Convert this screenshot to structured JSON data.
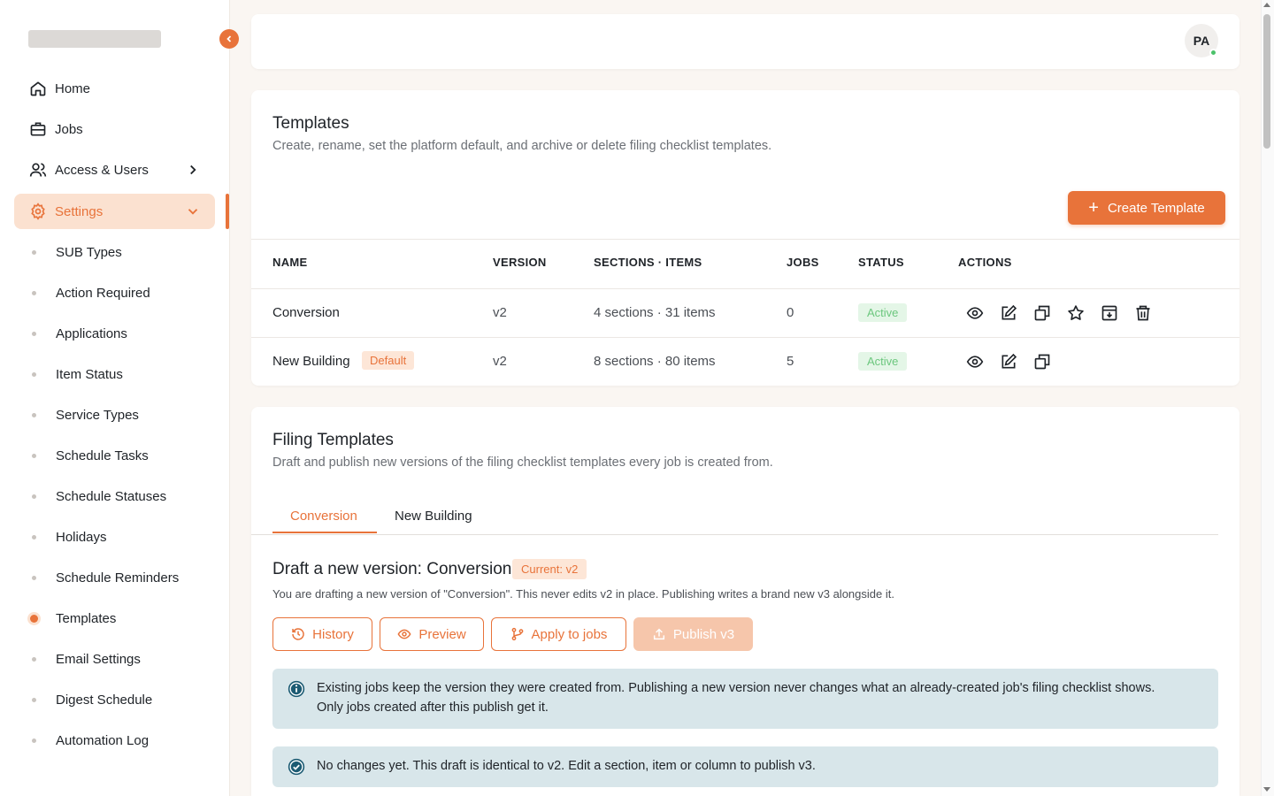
{
  "sidebar": {
    "main_items": [
      {
        "label": "Home",
        "icon": "home-icon"
      },
      {
        "label": "Jobs",
        "icon": "briefcase-icon"
      },
      {
        "label": "Access & Users",
        "icon": "users-icon"
      },
      {
        "label": "Settings",
        "icon": "gear-icon"
      }
    ],
    "sub_items": [
      "SUB Types",
      "Action Required",
      "Applications",
      "Item Status",
      "Service Types",
      "Schedule Tasks",
      "Schedule Statuses",
      "Holidays",
      "Schedule Reminders",
      "Templates",
      "Email Settings",
      "Digest Schedule",
      "Automation Log"
    ],
    "current_sub_item": "Templates"
  },
  "header": {
    "avatar_initials": "PA",
    "avatar_status": "online"
  },
  "templates_card": {
    "title": "Templates",
    "subtitle": "Create, rename, set the platform default, and archive or delete filing checklist templates.",
    "create_button": "Create Template",
    "columns": [
      "NAME",
      "VERSION",
      "SECTIONS · ITEMS",
      "JOBS",
      "STATUS",
      "ACTIONS"
    ],
    "rows": [
      {
        "name": "Conversion",
        "badge": "",
        "version": "v2",
        "sections_items": "4 sections · 31 items",
        "jobs": "0",
        "status": "Active",
        "actions": [
          "eye-icon",
          "edit-icon",
          "duplicate-icon",
          "star-icon",
          "archive-icon",
          "trash-icon"
        ]
      },
      {
        "name": "New Building",
        "badge": "Default",
        "version": "v2",
        "sections_items": "8 sections · 80 items",
        "jobs": "5",
        "status": "Active",
        "actions": [
          "eye-icon",
          "edit-icon",
          "duplicate-icon"
        ]
      }
    ]
  },
  "filing_card": {
    "title": "Filing Templates",
    "subtitle": "Draft and publish new versions of the filing checklist templates every job is created from.",
    "tabs": [
      "Conversion",
      "New Building"
    ],
    "selected_tab": "Conversion",
    "draft_title": "Draft a new version: Conversion",
    "current_badge": "Current: v2",
    "draft_description": "You are drafting a new version of \"Conversion\". This never edits v2 in place. Publishing writes a brand new v3 alongside it.",
    "buttons": {
      "history": "History",
      "preview": "Preview",
      "apply": "Apply to jobs",
      "publish": "Publish v3"
    },
    "notice_info": "Existing jobs keep the version they were created from. Publishing a new version never changes what an already-created job's filing checklist shows. Only jobs created after this publish get it.",
    "notice_status": "No changes yet. This draft is identical to v2. Edit a section, item or column to publish v3."
  },
  "colors": {
    "accent": "#e8733a",
    "accent_soft": "#fbe1d0",
    "active_green": "#6cc77e",
    "notice_bg": "#d8e6ea",
    "notice_icon": "#1c5b73"
  }
}
